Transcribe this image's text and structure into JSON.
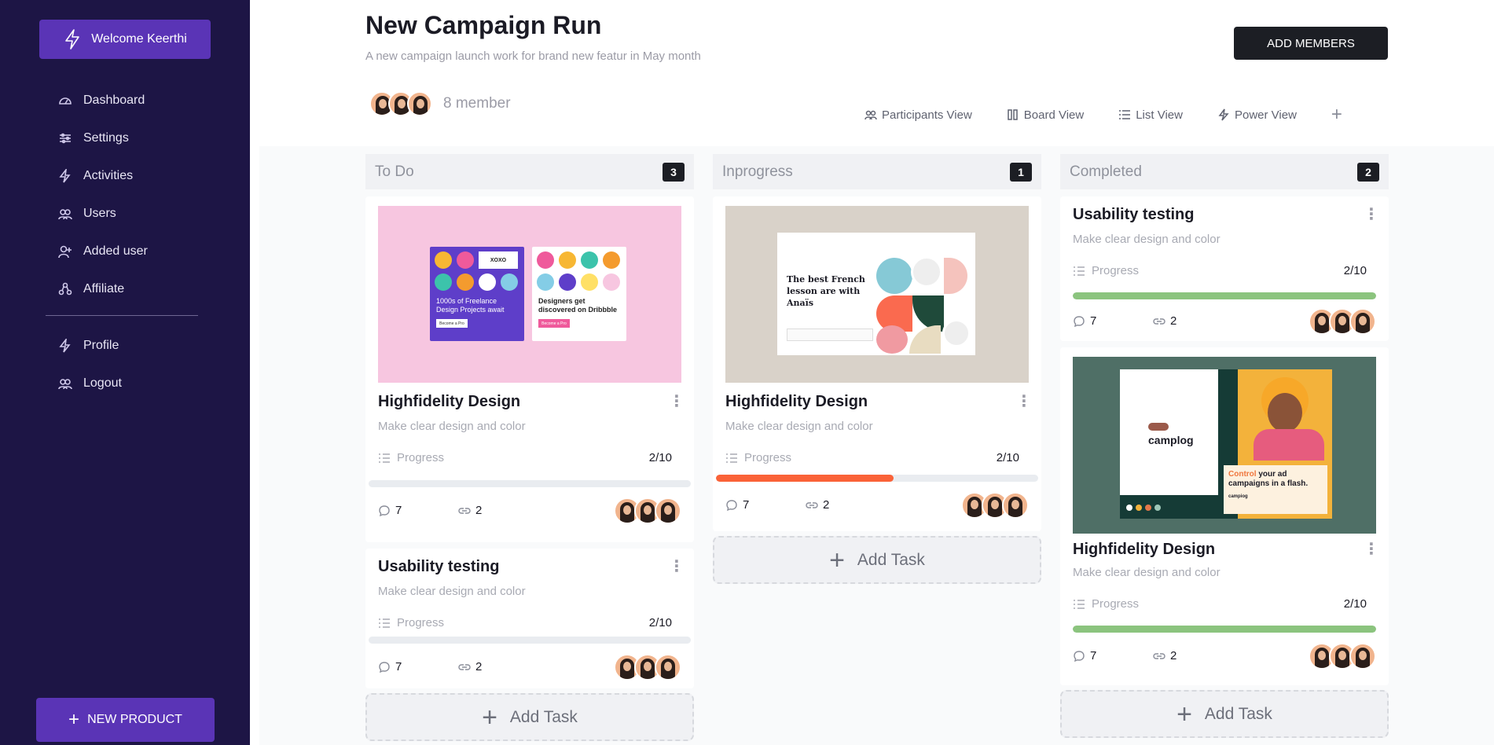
{
  "sidebar": {
    "welcome_label": "Welcome Keerthi",
    "items": [
      {
        "label": "Dashboard",
        "icon": "gauge-icon"
      },
      {
        "label": "Settings",
        "icon": "sliders-icon"
      },
      {
        "label": "Activities",
        "icon": "bolt-icon"
      },
      {
        "label": "Users",
        "icon": "users-icon"
      },
      {
        "label": "Added user",
        "icon": "user-plus-icon"
      },
      {
        "label": "Affiliate",
        "icon": "affiliate-icon"
      }
    ],
    "items2": [
      {
        "label": "Profile",
        "icon": "bolt-icon"
      },
      {
        "label": "Logout",
        "icon": "users-icon"
      }
    ],
    "new_product_label": "NEW PRODUCT"
  },
  "header": {
    "title": "New Campaign Run",
    "subtitle": "A new campaign launch work for brand new featur in May month",
    "add_members_label": "ADD MEMBERS",
    "member_count": "8 member"
  },
  "views": [
    {
      "label": "Participants View",
      "icon": "users-icon"
    },
    {
      "label": "Board View",
      "icon": "board-icon"
    },
    {
      "label": "List View",
      "icon": "list-icon"
    },
    {
      "label": "Power View",
      "icon": "bolt-icon"
    }
  ],
  "columns": [
    {
      "title": "To Do",
      "count": "3",
      "cards": [
        {
          "title": "Highfidelity Design",
          "description": "Make clear design and color",
          "progress_label": "Progress",
          "progress_value": "2/10",
          "progress_fraction": 0,
          "comments": "7",
          "links": "2",
          "image": "dribbble-promo-image"
        },
        {
          "title": "Usability testing",
          "description": "Make clear design and color",
          "progress_label": "Progress",
          "progress_value": "2/10",
          "progress_fraction": 0,
          "comments": "7",
          "links": "2"
        }
      ],
      "add_task_label": "Add Task"
    },
    {
      "title": "Inprogress",
      "count": "1",
      "cards": [
        {
          "title": "Highfidelity Design",
          "description": "Make clear design and color",
          "progress_label": "Progress",
          "progress_value": "2/10",
          "progress_fraction": 0.55,
          "progress_color": "#fa6238",
          "comments": "7",
          "links": "2",
          "image": "french-lesson-image"
        }
      ],
      "add_task_label": "Add Task"
    },
    {
      "title": "Completed",
      "count": "2",
      "cards": [
        {
          "title": "Usability testing",
          "description": "Make clear design and color",
          "progress_label": "Progress",
          "progress_value": "2/10",
          "progress_fraction": 1,
          "progress_color": "#8bc47e",
          "comments": "7",
          "links": "2"
        },
        {
          "title": "Highfidelity Design",
          "description": "Make clear design and color",
          "progress_label": "Progress",
          "progress_value": "2/10",
          "progress_fraction": 1,
          "progress_color": "#8bc47e",
          "comments": "7",
          "links": "2",
          "image": "campaign-ad-image"
        }
      ],
      "add_task_label": "Add Task"
    }
  ],
  "image_text": {
    "dribbble_left": "1000s of Freelance Design Projects await",
    "dribbble_left_btn": "Become a Pro",
    "dribbble_right": "Designers get discovered on Dribbble",
    "dribbble_right_btn": "Become a Pro",
    "dribbble_xoxo": "XOXO",
    "french": "The best French lesson are with Anaïs",
    "campaign_logo": "camplog",
    "campaign_text_accent": "Control",
    "campaign_text": " your ad campaigns in a flash.",
    "campaign_small": "campiog"
  },
  "colors": {
    "sidebar_bg": "#1d1545",
    "accent": "#5a34b6",
    "inprogress": "#fa6238",
    "completed": "#8bc47e"
  }
}
